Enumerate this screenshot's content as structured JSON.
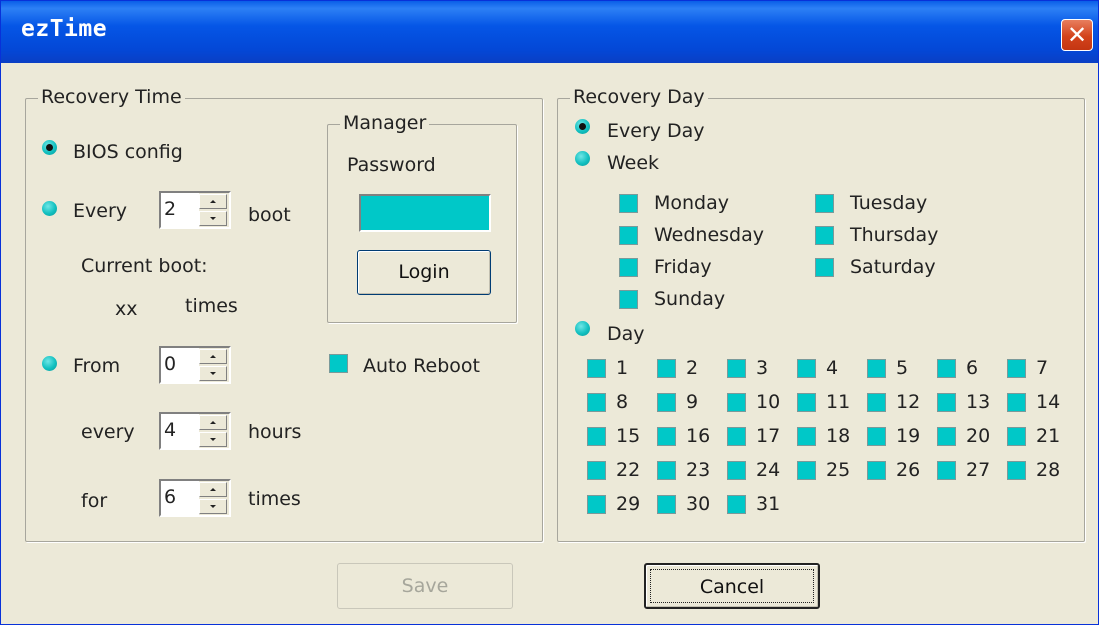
{
  "window": {
    "title": "ezTime",
    "close_icon": "✕"
  },
  "recovery_time": {
    "legend": "Recovery Time",
    "bios_config": "BIOS config",
    "every_label": "Every",
    "every_value": "2",
    "boot_label": "boot",
    "current_boot_label": "Current boot:",
    "current_boot_value": "xx",
    "times_label": "times",
    "from_label": "From",
    "from_value": "0",
    "every2_label": "every",
    "every2_value": "4",
    "hours_label": "hours",
    "for_label": "for",
    "for_value": "6",
    "times2_label": "times",
    "selected": "bios_config"
  },
  "manager": {
    "legend": "Manager",
    "password_label": "Password",
    "login_button": "Login"
  },
  "auto_reboot": {
    "label": "Auto Reboot",
    "checked": true
  },
  "recovery_day": {
    "legend": "Recovery Day",
    "every_day": "Every Day",
    "week": "Week",
    "day": "Day",
    "selected": "every_day",
    "weekdays": [
      "Monday",
      "Tuesday",
      "Wednesday",
      "Thursday",
      "Friday",
      "Saturday",
      "Sunday"
    ],
    "days": [
      "1",
      "2",
      "3",
      "4",
      "5",
      "6",
      "7",
      "8",
      "9",
      "10",
      "11",
      "12",
      "13",
      "14",
      "15",
      "16",
      "17",
      "18",
      "19",
      "20",
      "21",
      "22",
      "23",
      "24",
      "25",
      "26",
      "27",
      "28",
      "29",
      "30",
      "31"
    ]
  },
  "buttons": {
    "save": "Save",
    "cancel": "Cancel"
  },
  "colors": {
    "accent": "#00c8c8",
    "titlebar": "#0447d6",
    "face": "#ece9d8"
  }
}
